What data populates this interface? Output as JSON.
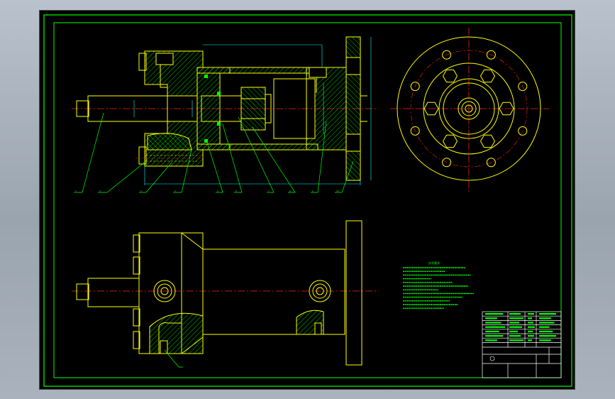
{
  "colors": {
    "background": "#000000",
    "outline": "#ffff00",
    "centerline": "#ff2020",
    "hatch": "#00ff00",
    "dimension": "#00ffff",
    "leader": "#00ff00",
    "notes": "#00ff00",
    "frame": "#00ff00",
    "title_block": "#ffffff"
  },
  "drawing": {
    "title": "",
    "notes_heading": "技术要求"
  },
  "balloons": [
    "1",
    "2",
    "3",
    "4",
    "5",
    "6",
    "7",
    "8",
    "9",
    "10"
  ],
  "section_view": {
    "name": "main-section-view"
  },
  "end_view": {
    "name": "flange-end-view",
    "bolt_count": 8
  },
  "outside_view": {
    "name": "outside-view"
  }
}
